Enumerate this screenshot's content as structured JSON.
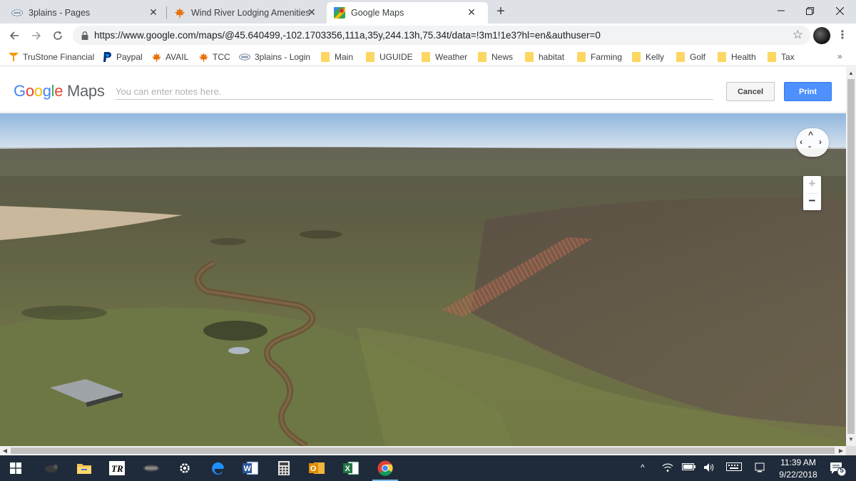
{
  "browser": {
    "tabs": [
      {
        "title": "3plains - Pages",
        "favicon": "3plains-icon",
        "active": false
      },
      {
        "title": "Wind River Lodging Amenities lis",
        "favicon": "maple-leaf-icon",
        "active": false
      },
      {
        "title": "Google Maps",
        "favicon": "google-maps-icon",
        "active": true
      }
    ],
    "close_glyph": "✕",
    "new_tab_glyph": "+",
    "url": "https://www.google.com/maps/@45.640499,-102.1703356,111a,35y,244.13h,75.34t/data=!3m1!1e3?hl=en&authuser=0",
    "bookmarks": [
      {
        "label": "TruStone Financial",
        "icon": "trustone-icon"
      },
      {
        "label": "Paypal",
        "icon": "paypal-icon"
      },
      {
        "label": "AVAIL",
        "icon": "maple-leaf-icon"
      },
      {
        "label": "TCC",
        "icon": "maple-leaf-icon"
      },
      {
        "label": "3plains - Login",
        "icon": "3plains-icon"
      },
      {
        "label": "Main",
        "icon": "folder-icon"
      },
      {
        "label": "UGUIDE",
        "icon": "folder-icon"
      },
      {
        "label": "Weather",
        "icon": "folder-icon"
      },
      {
        "label": "News",
        "icon": "folder-icon"
      },
      {
        "label": "habitat",
        "icon": "folder-icon"
      },
      {
        "label": "Farming",
        "icon": "folder-icon"
      },
      {
        "label": "Kelly",
        "icon": "folder-icon"
      },
      {
        "label": "Golf",
        "icon": "folder-icon"
      },
      {
        "label": "Health",
        "icon": "folder-icon"
      },
      {
        "label": "Tax",
        "icon": "folder-icon"
      }
    ],
    "bookmarks_more": "»"
  },
  "maps": {
    "logo_google": "Google",
    "logo_maps": "Maps",
    "notes_placeholder": "You can enter notes here.",
    "notes_value": "",
    "cancel_label": "Cancel",
    "print_label": "Print",
    "zoom_in": "+",
    "zoom_out": "−"
  },
  "taskbar": {
    "time": "11:39 AM",
    "date": "9/22/2018",
    "notification_count": "5"
  },
  "colors": {
    "tabstrip": "#dee1e6",
    "print_button": "#4d90fe",
    "taskbar": "#1f2b3a",
    "google_blue": "#4285f4",
    "google_red": "#ea4335",
    "google_yellow": "#fbbc05",
    "google_green": "#34a853"
  }
}
